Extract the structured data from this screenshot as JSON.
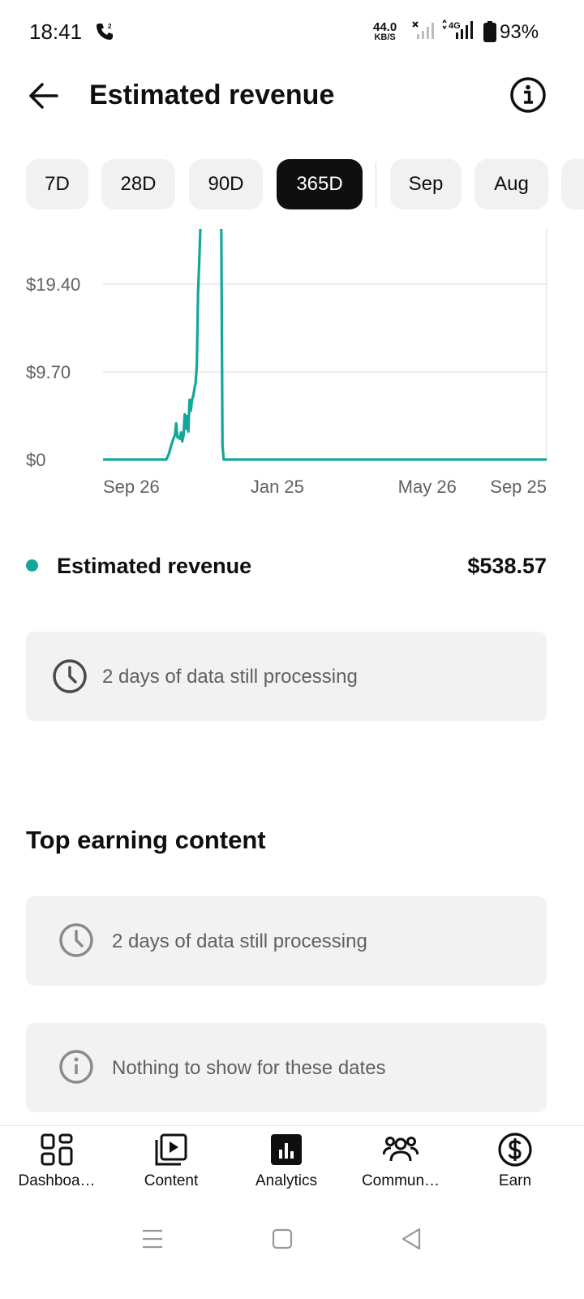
{
  "status_bar": {
    "time": "18:41",
    "speed_value": "44.0",
    "speed_unit": "KB/S",
    "network": "4G",
    "battery": "93%"
  },
  "header": {
    "title": "Estimated revenue"
  },
  "chips": [
    "7D",
    "28D",
    "90D",
    "365D",
    "Sep",
    "Aug"
  ],
  "selected_chip": "365D",
  "chart_data": {
    "type": "line",
    "color": "#12a798",
    "y_ticks": [
      "$0",
      "$9.70",
      "$19.40"
    ],
    "y_tick_values": [
      0,
      9.7,
      19.4
    ],
    "x_ticks": [
      "Sep 26",
      "Jan 25",
      "May 26",
      "Sep 25"
    ],
    "x_tick_days": [
      0,
      121,
      242,
      364
    ],
    "ylim": [
      0,
      25.5
    ],
    "xlim": [
      0,
      364
    ],
    "series": [
      {
        "points": [
          [
            0,
            0
          ],
          [
            52,
            0
          ],
          [
            54,
            0.6
          ],
          [
            56,
            1.6
          ],
          [
            58,
            2.4
          ],
          [
            59,
            2.7
          ],
          [
            60,
            4.0
          ],
          [
            61,
            2.5
          ],
          [
            63,
            2.3
          ],
          [
            64,
            3.0
          ],
          [
            65,
            2.0
          ],
          [
            66,
            2.6
          ],
          [
            67,
            5.0
          ],
          [
            68,
            3.4
          ],
          [
            69,
            4.8
          ],
          [
            70,
            3.1
          ],
          [
            71,
            6.6
          ],
          [
            72,
            5.4
          ],
          [
            73,
            6.6
          ],
          [
            74,
            7.0
          ],
          [
            75,
            7.8
          ],
          [
            76,
            8.5
          ],
          [
            77,
            10.5
          ],
          [
            78,
            18.5
          ],
          [
            79,
            22.0
          ],
          [
            80,
            26.0
          ],
          [
            81,
            25.8
          ],
          [
            82,
            26.0
          ],
          [
            83,
            26.0
          ],
          [
            84,
            26.0
          ],
          [
            85,
            26.0
          ],
          [
            97,
            26.0
          ],
          [
            98,
            1.5
          ],
          [
            99,
            0
          ],
          [
            364,
            0
          ]
        ]
      }
    ]
  },
  "legend": {
    "label": "Estimated revenue",
    "value": "$538.57"
  },
  "processing_card": {
    "text": "2 days of data still processing"
  },
  "top_earning": {
    "title": "Top earning content",
    "processing_text": "2 days of data still processing",
    "empty_text": "Nothing to show for these dates"
  },
  "bottom_nav": {
    "items": [
      {
        "label": "Dashboa…",
        "icon": "dashboard-icon"
      },
      {
        "label": "Content",
        "icon": "content-icon"
      },
      {
        "label": "Analytics",
        "icon": "analytics-icon"
      },
      {
        "label": "Commun…",
        "icon": "community-icon"
      },
      {
        "label": "Earn",
        "icon": "earn-icon"
      }
    ],
    "active": "Analytics"
  }
}
